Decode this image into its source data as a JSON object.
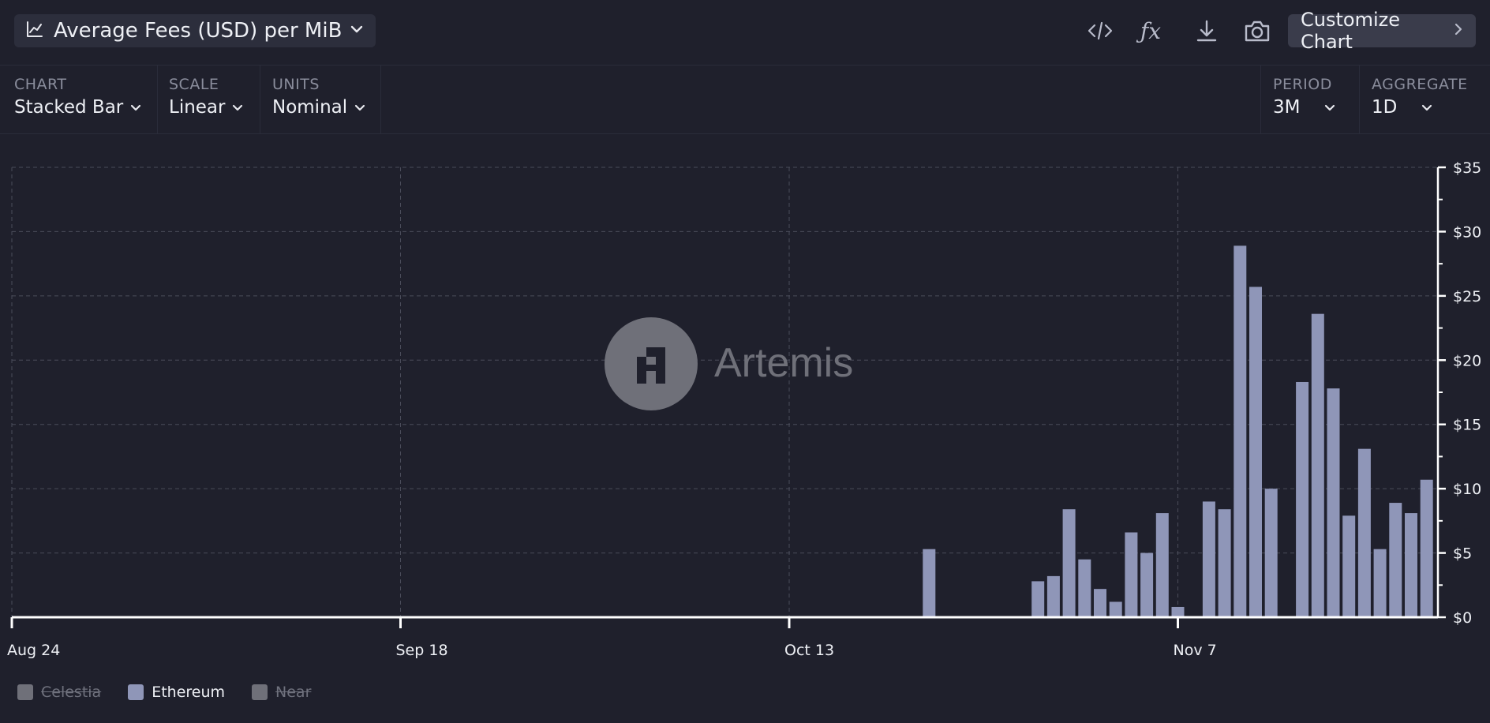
{
  "header": {
    "title": "Average Fees (USD) per MiB",
    "customize_label": "Customize Chart"
  },
  "controls": {
    "chart": {
      "label": "CHART",
      "value": "Stacked Bar"
    },
    "scale": {
      "label": "SCALE",
      "value": "Linear"
    },
    "units": {
      "label": "UNITS",
      "value": "Nominal"
    },
    "period": {
      "label": "PERIOD",
      "value": "3M"
    },
    "aggregate": {
      "label": "AGGREGATE",
      "value": "1D"
    }
  },
  "icons": {
    "title": "line-chart-icon",
    "tools": [
      "code-icon",
      "fx-icon",
      "download-icon",
      "camera-icon"
    ]
  },
  "watermark": "Artemis",
  "chart_data": {
    "type": "bar",
    "stacked": true,
    "start_date": "2024-08-24",
    "x_tick_labels": [
      "Aug 24",
      "Sep 18",
      "Oct 13",
      "Nov 7"
    ],
    "x_tick_dates": [
      "2024-08-24",
      "2024-09-18",
      "2024-10-13",
      "2024-11-07"
    ],
    "ylim": [
      0,
      35
    ],
    "y_ticks": [
      0,
      5,
      10,
      15,
      20,
      25,
      30,
      35
    ],
    "y_tick_labels": [
      "$0",
      "$5",
      "$10",
      "$15",
      "$20",
      "$25",
      "$30",
      "$35"
    ],
    "grid": true,
    "legend_position": "bottom-left",
    "series": [
      {
        "name": "Celestia",
        "color": "#6f7079",
        "active": false,
        "dates": [],
        "values": []
      },
      {
        "name": "Ethereum",
        "color": "#8f96b8",
        "active": true,
        "dates": [
          "2024-10-22",
          "2024-10-29",
          "2024-10-30",
          "2024-10-31",
          "2024-11-01",
          "2024-11-02",
          "2024-11-03",
          "2024-11-04",
          "2024-11-05",
          "2024-11-06",
          "2024-11-07",
          "2024-11-09",
          "2024-11-10",
          "2024-11-11",
          "2024-11-12",
          "2024-11-13",
          "2024-11-15",
          "2024-11-16",
          "2024-11-17",
          "2024-11-18",
          "2024-11-19",
          "2024-11-20",
          "2024-11-21",
          "2024-11-22",
          "2024-11-23"
        ],
        "values": [
          5.3,
          2.8,
          3.2,
          8.4,
          4.5,
          2.2,
          1.2,
          6.6,
          5.0,
          8.1,
          0.8,
          9.0,
          8.4,
          28.9,
          25.7,
          10.0,
          18.3,
          23.6,
          17.8,
          7.9,
          13.1,
          5.3,
          8.9,
          8.1,
          10.7
        ]
      },
      {
        "name": "Near",
        "color": "#6f7079",
        "active": false,
        "dates": [],
        "values": []
      }
    ]
  }
}
